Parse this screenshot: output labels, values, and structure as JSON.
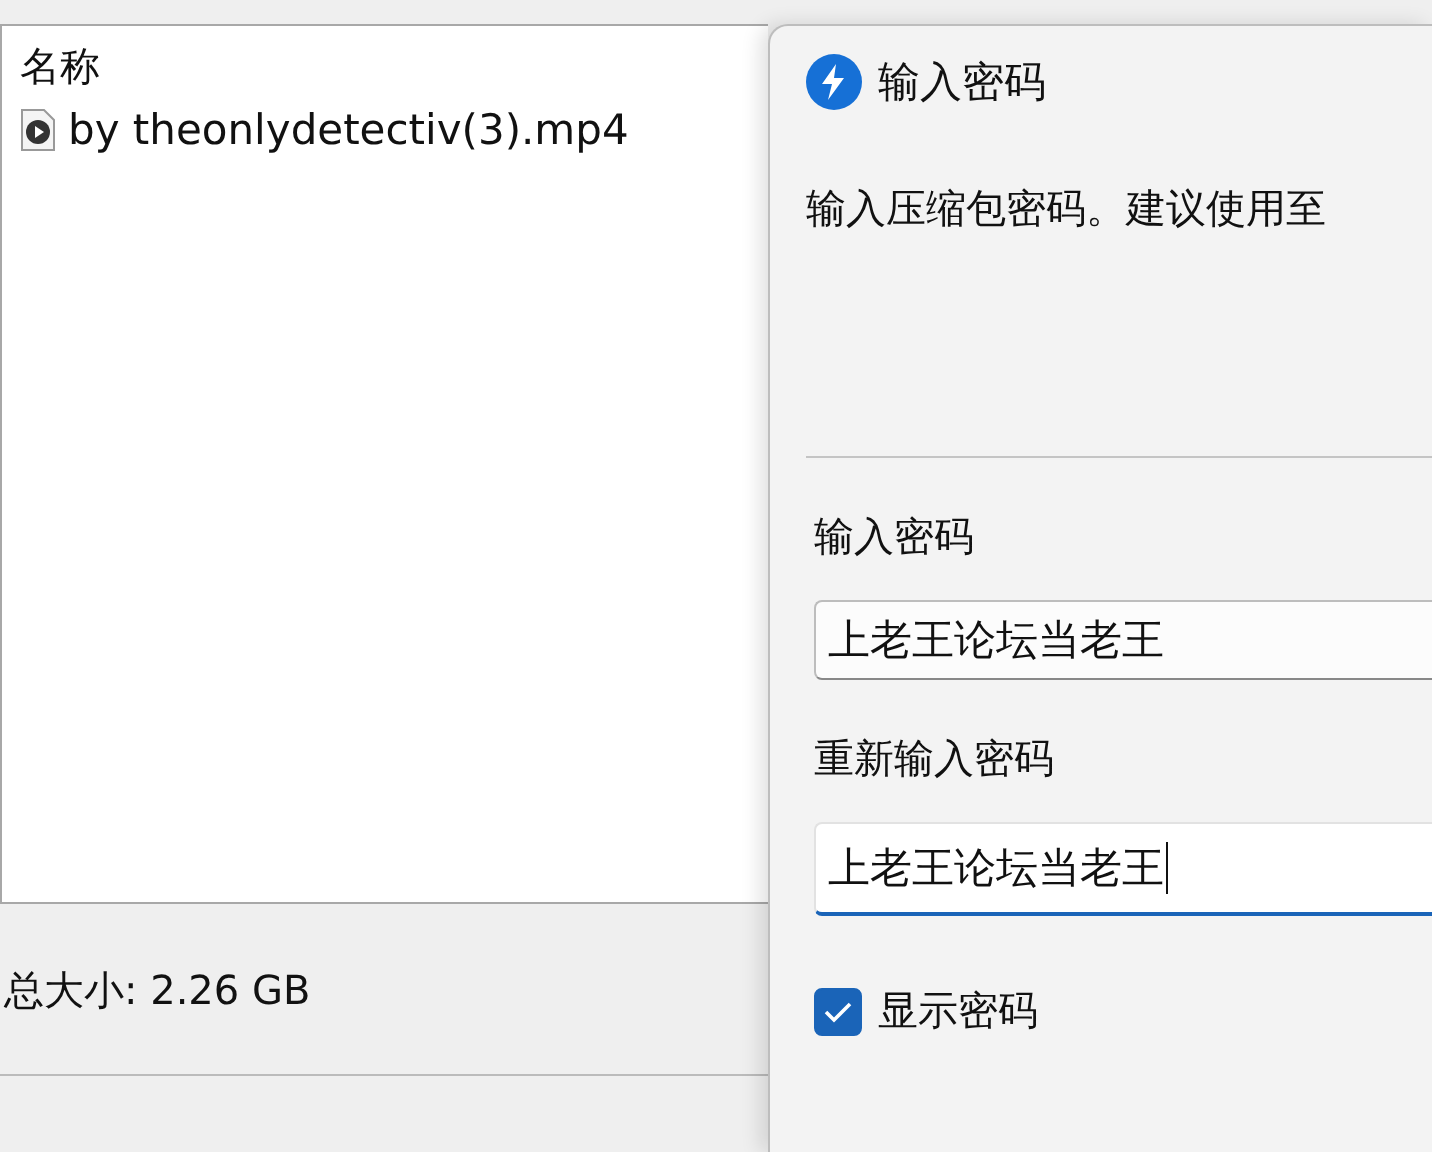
{
  "file_list": {
    "columns": [
      "名称"
    ],
    "rows": [
      {
        "name": "by theonlydetectiv(3).mp4"
      }
    ]
  },
  "total_size": "总大小: 2.26 GB",
  "dialog": {
    "title": "输入密码",
    "description": "输入压缩包密码。建议使用至",
    "fields": [
      {
        "label": "输入密码",
        "value": "上老王论坛当老王",
        "focused": false
      },
      {
        "label": "重新输入密码",
        "value": "上老王论坛当老王",
        "focused": true
      }
    ],
    "show_password": {
      "label": "显示密码",
      "checked": true
    }
  }
}
